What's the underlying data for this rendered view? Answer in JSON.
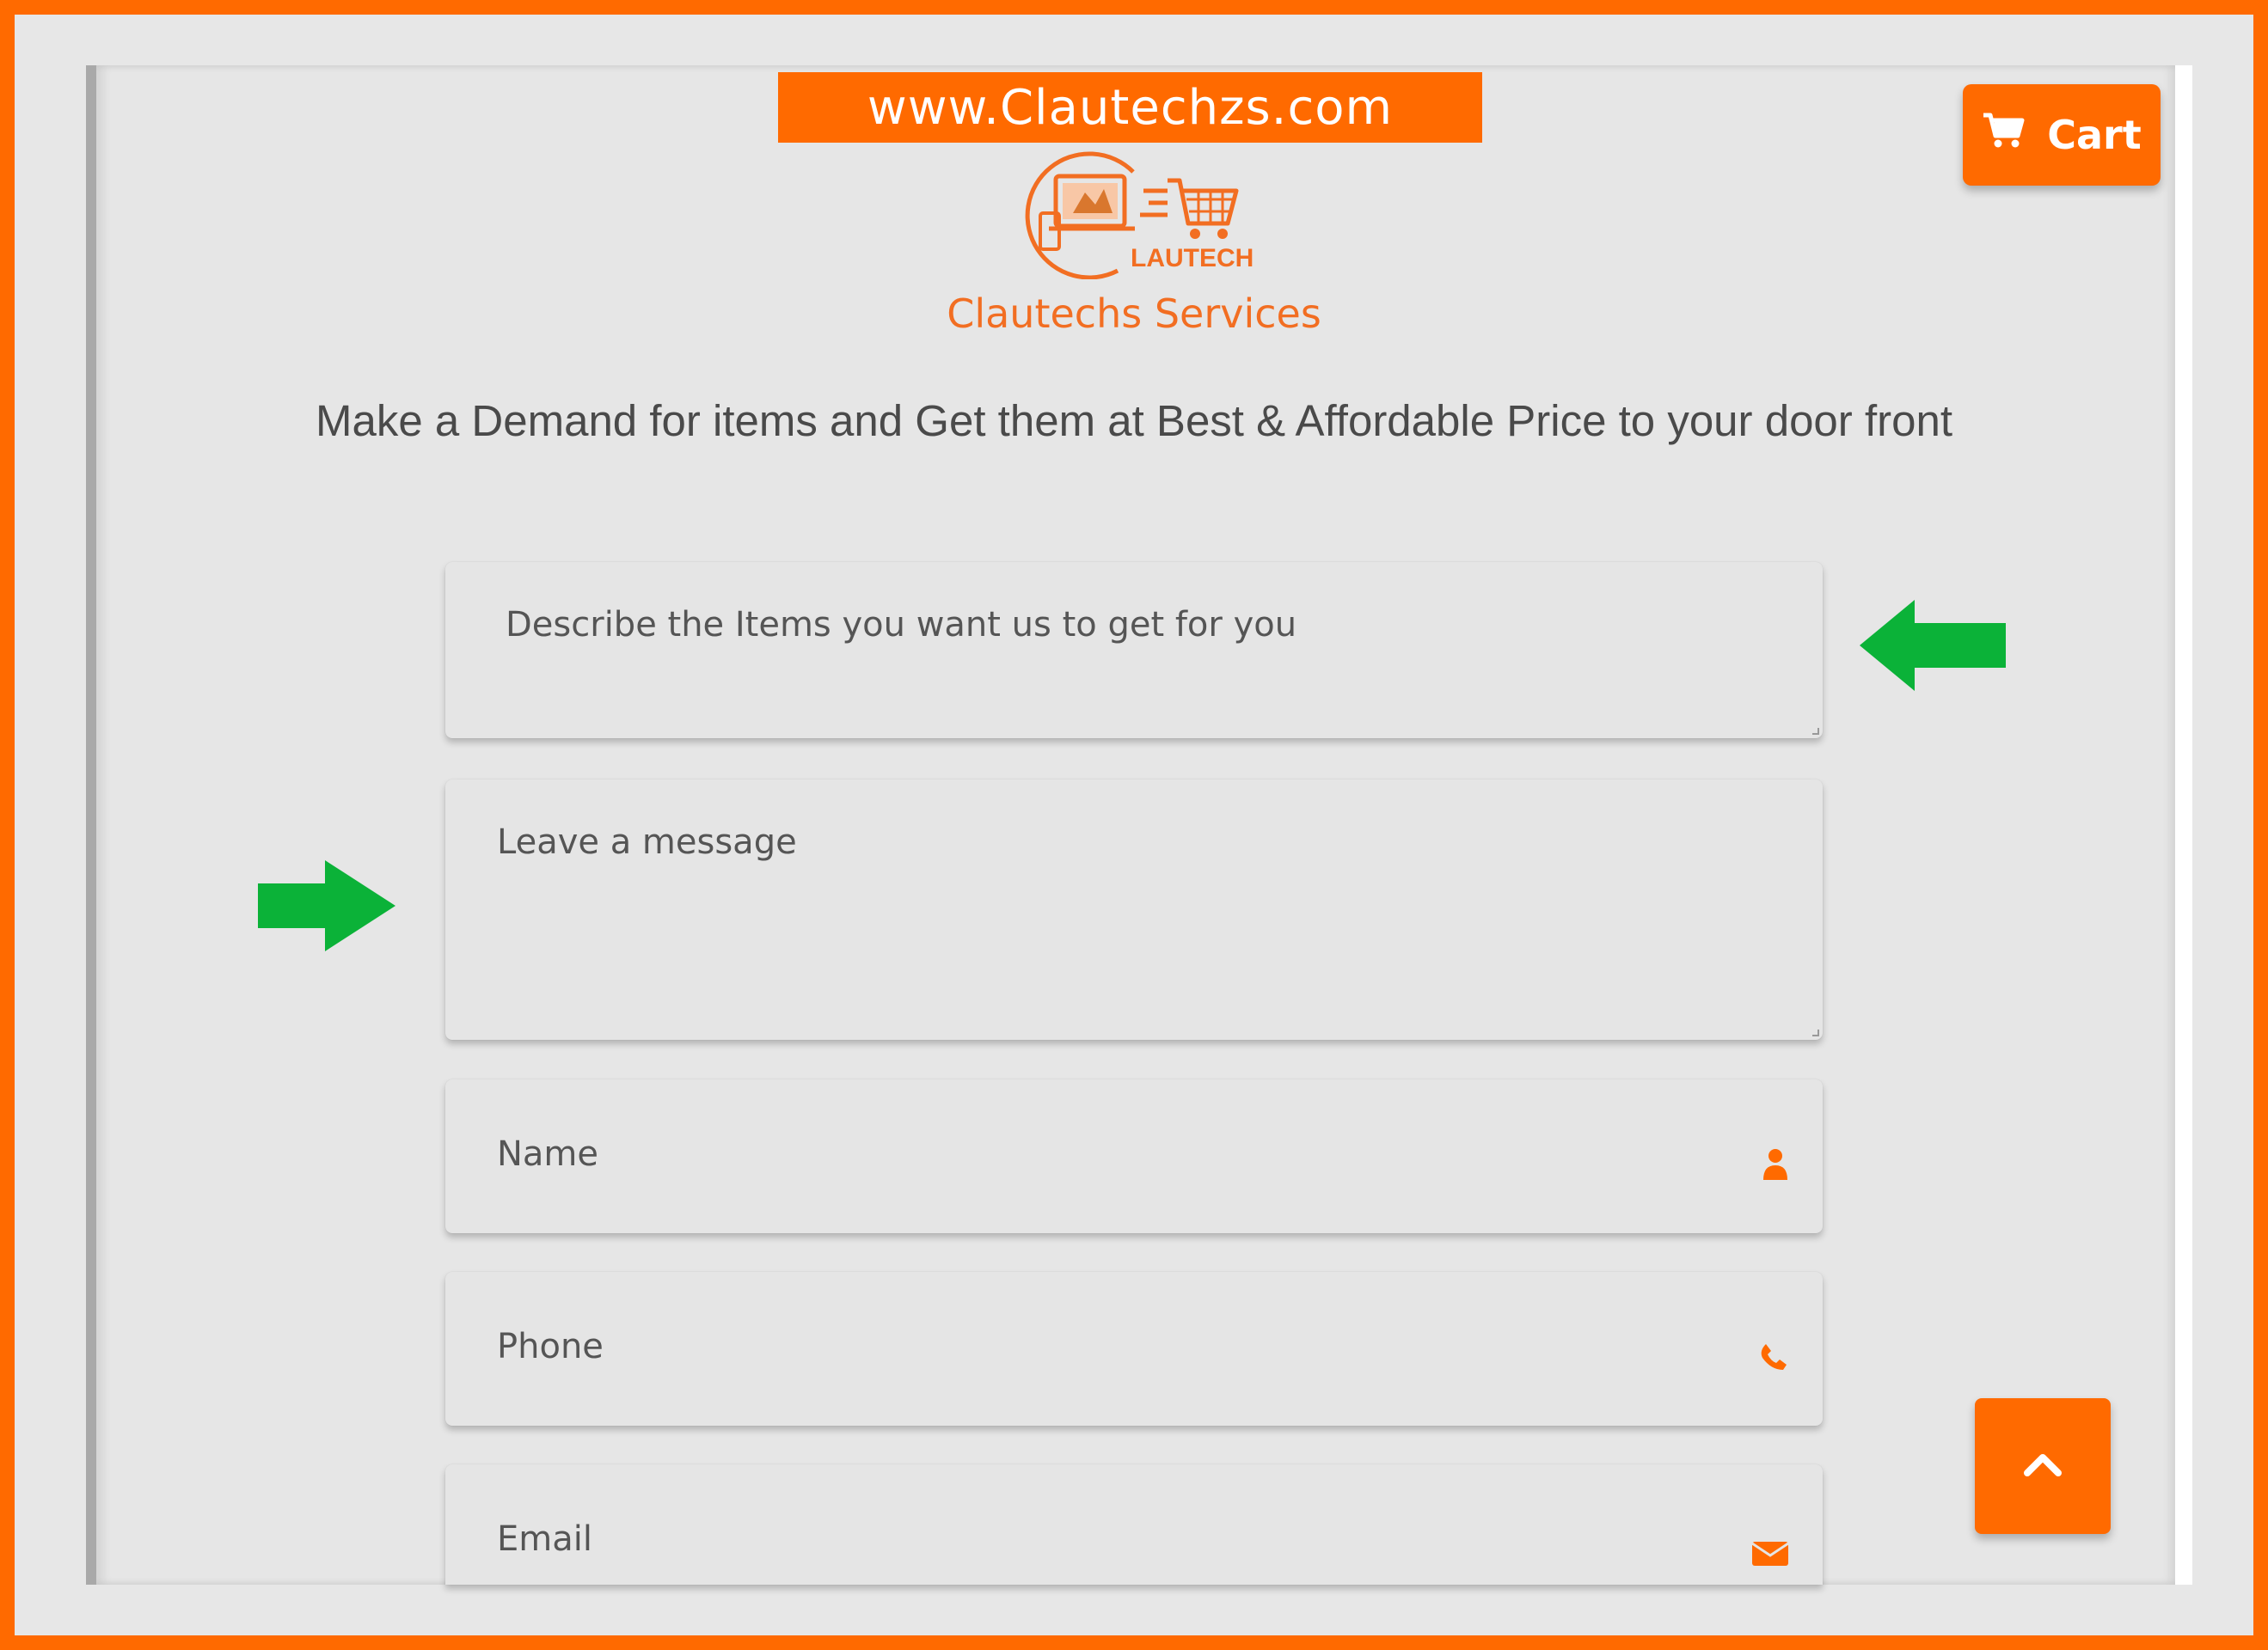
{
  "site": {
    "url_banner": "www.Clautechzs.com",
    "logo_text": "LAUTECH",
    "brand_name": "Clautechs Services",
    "tagline": "Make a Demand for items and Get them at Best & Affordable Price to your door front"
  },
  "header": {
    "cart_label": "Cart",
    "cart_icon": "shopping-cart-icon"
  },
  "form": {
    "items_description_placeholder": "Describe the Items you want us to get for you",
    "message_placeholder": "Leave a message",
    "name_placeholder": "Name",
    "name_icon": "user-icon",
    "phone_placeholder": "Phone",
    "phone_icon": "phone-icon",
    "email_placeholder": "Email",
    "email_icon": "envelope-icon"
  },
  "annotations": {
    "arrow_color": "#0BB238",
    "arrows": [
      "arrow-left-icon",
      "arrow-right-icon"
    ]
  },
  "colors": {
    "accent": "#FF6A00",
    "brand_text": "#F26E22",
    "page_background": "#E7E7E7"
  },
  "back_to_top_icon": "chevron-up-icon"
}
